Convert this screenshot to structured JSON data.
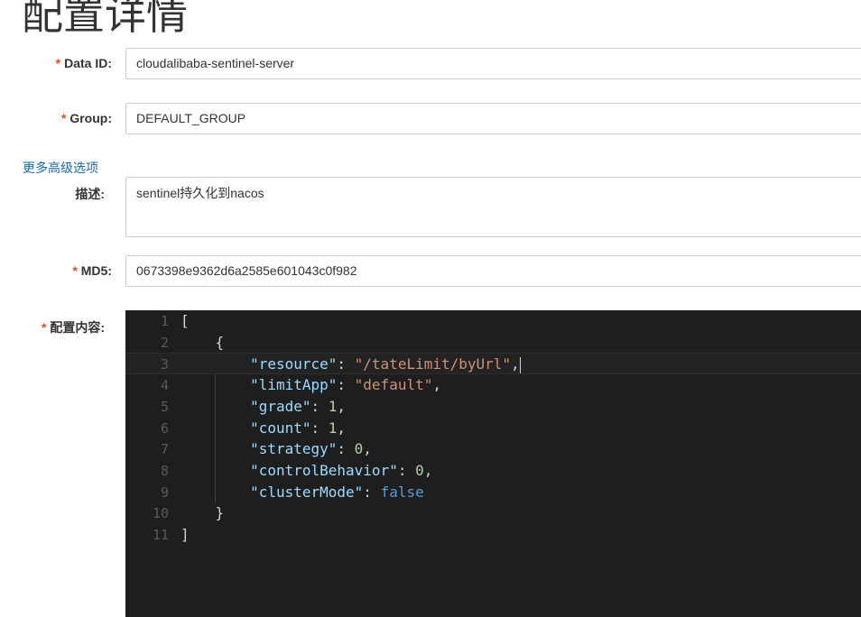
{
  "page": {
    "title": "配置详情"
  },
  "form": {
    "data_id": {
      "required": "*",
      "label": "Data ID:",
      "value": "cloudalibaba-sentinel-server"
    },
    "group": {
      "required": "*",
      "label": "Group:",
      "value": "DEFAULT_GROUP"
    },
    "advanced_link": "更多高级选项",
    "description": {
      "label": "描述:",
      "value": "sentinel持久化到nacos"
    },
    "md5": {
      "required": "*",
      "label": "MD5:",
      "value": "0673398e9362d6a2585e601043c0f982"
    },
    "content": {
      "required": "*",
      "label": "配置内容:"
    }
  },
  "editor": {
    "line_numbers": [
      "1",
      "2",
      "3",
      "4",
      "5",
      "6",
      "7",
      "8",
      "9",
      "10",
      "11"
    ],
    "lines": [
      [
        {
          "t": "[",
          "c": "p"
        }
      ],
      [
        {
          "t": "    {",
          "c": "p"
        }
      ],
      [
        {
          "t": "        ",
          "c": "p"
        },
        {
          "t": "\"resource\"",
          "c": "key"
        },
        {
          "t": ": ",
          "c": "p"
        },
        {
          "t": "\"/tateLimit/byUrl\"",
          "c": "str"
        },
        {
          "t": ",",
          "c": "p"
        }
      ],
      [
        {
          "t": "        ",
          "c": "p"
        },
        {
          "t": "\"limitApp\"",
          "c": "key"
        },
        {
          "t": ": ",
          "c": "p"
        },
        {
          "t": "\"default\"",
          "c": "str"
        },
        {
          "t": ",",
          "c": "p"
        }
      ],
      [
        {
          "t": "        ",
          "c": "p"
        },
        {
          "t": "\"grade\"",
          "c": "key"
        },
        {
          "t": ": ",
          "c": "p"
        },
        {
          "t": "1",
          "c": "num"
        },
        {
          "t": ",",
          "c": "p"
        }
      ],
      [
        {
          "t": "        ",
          "c": "p"
        },
        {
          "t": "\"count\"",
          "c": "key"
        },
        {
          "t": ": ",
          "c": "p"
        },
        {
          "t": "1",
          "c": "num"
        },
        {
          "t": ",",
          "c": "p"
        }
      ],
      [
        {
          "t": "        ",
          "c": "p"
        },
        {
          "t": "\"strategy\"",
          "c": "key"
        },
        {
          "t": ": ",
          "c": "p"
        },
        {
          "t": "0",
          "c": "num"
        },
        {
          "t": ",",
          "c": "p"
        }
      ],
      [
        {
          "t": "        ",
          "c": "p"
        },
        {
          "t": "\"controlBehavior\"",
          "c": "key"
        },
        {
          "t": ": ",
          "c": "p"
        },
        {
          "t": "0",
          "c": "num"
        },
        {
          "t": ",",
          "c": "p"
        }
      ],
      [
        {
          "t": "        ",
          "c": "p"
        },
        {
          "t": "\"clusterMode\"",
          "c": "key"
        },
        {
          "t": ": ",
          "c": "p"
        },
        {
          "t": "false",
          "c": "kw"
        }
      ],
      [
        {
          "t": "    }",
          "c": "p"
        }
      ],
      [
        {
          "t": "]",
          "c": "p"
        }
      ]
    ],
    "cursor_line": 3
  }
}
